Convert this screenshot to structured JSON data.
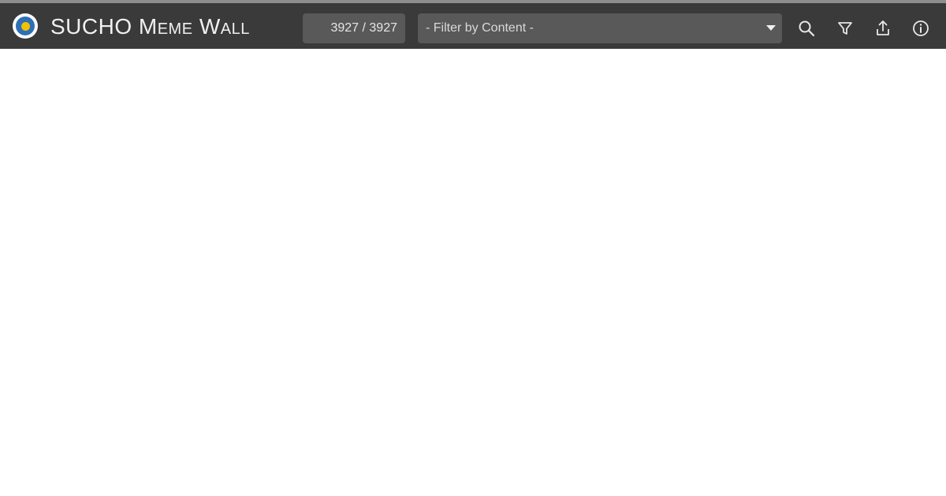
{
  "header": {
    "app_title": "SUCHO Meme Wall",
    "counter": "3927 / 3927",
    "filter_placeholder": "- Filter by Content -",
    "icons": [
      "search-icon",
      "filter-icon",
      "share-icon",
      "info-icon"
    ]
  }
}
